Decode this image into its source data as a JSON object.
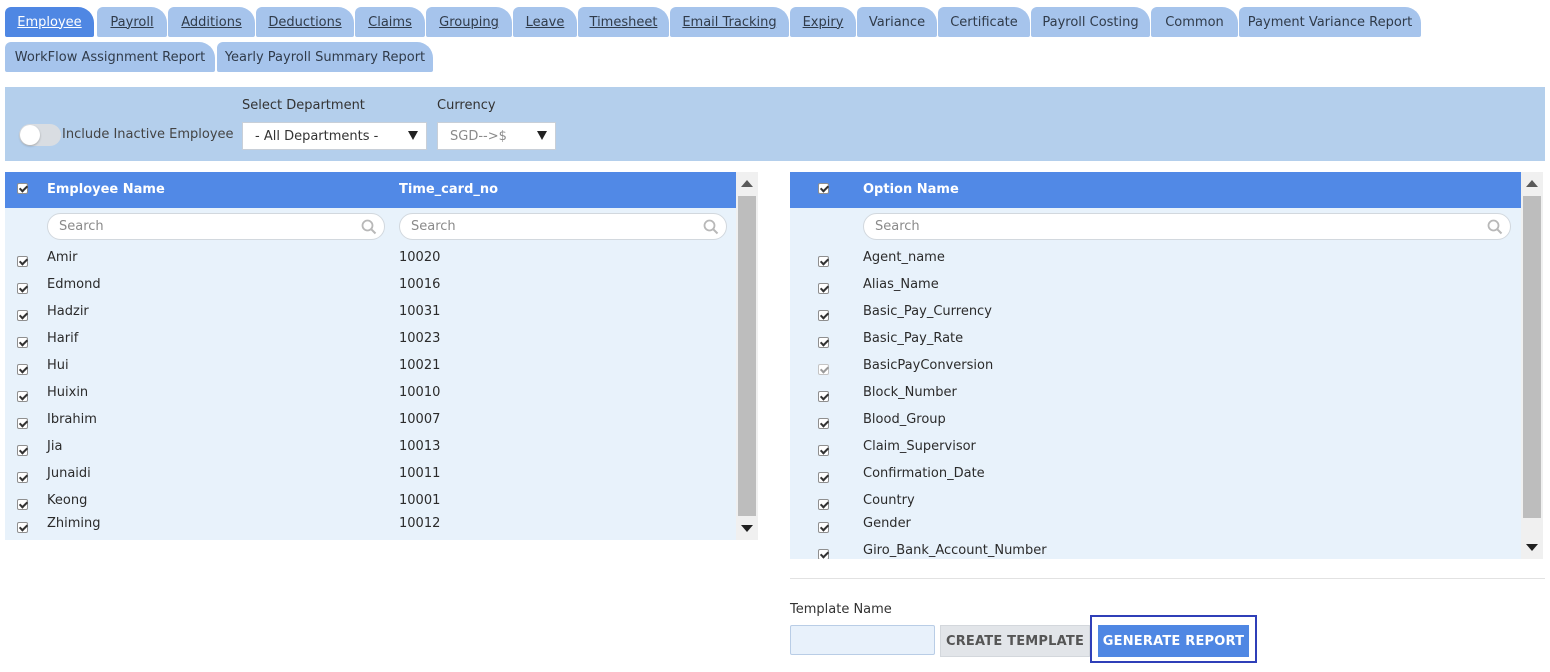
{
  "tabs": [
    {
      "label": "Employee",
      "active": true
    },
    {
      "label": "Payroll"
    },
    {
      "label": "Additions"
    },
    {
      "label": "Deductions"
    },
    {
      "label": "Claims"
    },
    {
      "label": "Grouping"
    },
    {
      "label": "Leave"
    },
    {
      "label": "Timesheet"
    },
    {
      "label": "Email Tracking"
    },
    {
      "label": "Expiry"
    },
    {
      "label": "Variance"
    },
    {
      "label": "Certificate"
    },
    {
      "label": "Payroll Costing"
    },
    {
      "label": "Common"
    },
    {
      "label": "Payment Variance Report"
    },
    {
      "label": "WorkFlow Assignment Report"
    },
    {
      "label": "Yearly Payroll Summary Report"
    }
  ],
  "filters": {
    "include_inactive_label": "Include Inactive Employee",
    "include_inactive": false,
    "department_label": "Select Department",
    "department_value": "- All Departments -",
    "currency_label": "Currency",
    "currency_value": "SGD-->$"
  },
  "employee_grid": {
    "columns": [
      "Employee Name",
      "Time_card_no"
    ],
    "search_placeholder": "Search",
    "rows": [
      {
        "name": "Amir",
        "card": "10020"
      },
      {
        "name": "Edmond",
        "card": "10016"
      },
      {
        "name": "Hadzir",
        "card": "10031"
      },
      {
        "name": "Harif",
        "card": "10023"
      },
      {
        "name": "Hui",
        "card": "10021"
      },
      {
        "name": "Huixin",
        "card": "10010"
      },
      {
        "name": "Ibrahim",
        "card": "10007"
      },
      {
        "name": "Jia",
        "card": "10013"
      },
      {
        "name": "Junaidi",
        "card": "10011"
      },
      {
        "name": "Keong",
        "card": "10001"
      },
      {
        "name": "Zhiming",
        "card": "10012"
      }
    ]
  },
  "option_grid": {
    "column": "Option Name",
    "search_placeholder": "Search",
    "rows": [
      {
        "name": "Agent_name"
      },
      {
        "name": "Alias_Name"
      },
      {
        "name": "Basic_Pay_Currency"
      },
      {
        "name": "Basic_Pay_Rate"
      },
      {
        "name": "BasicPayConversion",
        "disabled": true
      },
      {
        "name": "Block_Number"
      },
      {
        "name": "Blood_Group"
      },
      {
        "name": "Claim_Supervisor"
      },
      {
        "name": "Confirmation_Date"
      },
      {
        "name": "Country"
      },
      {
        "name": "Gender"
      },
      {
        "name": "Giro_Bank_Account_Number"
      }
    ]
  },
  "template": {
    "label": "Template Name",
    "value": "",
    "create_label": "CREATE TEMPLATE",
    "generate_label": "GENERATE REPORT"
  },
  "colors": {
    "tab": "#a6c4ec",
    "tab_active": "#4f87e3",
    "filter_bar": "#b4cfec",
    "grid_header": "#5189e6",
    "grid_body": "#e8f2fb",
    "focus_ring": "#2f3fb8"
  }
}
